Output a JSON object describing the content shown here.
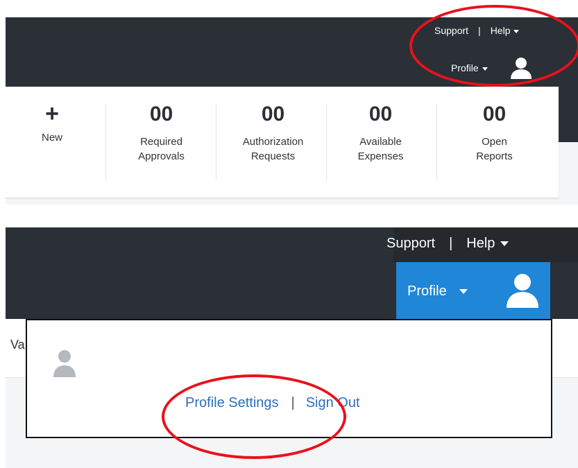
{
  "panel1": {
    "utility_nav": {
      "support": "Support",
      "separator": "|",
      "help": "Help"
    },
    "profile_label": "Profile",
    "tiles": [
      {
        "value": "+",
        "line1": "New",
        "line2": ""
      },
      {
        "value": "00",
        "line1": "Required",
        "line2": "Approvals"
      },
      {
        "value": "00",
        "line1": "Authorization",
        "line2": "Requests"
      },
      {
        "value": "00",
        "line1": "Available",
        "line2": "Expenses"
      },
      {
        "value": "00",
        "line1": "Open",
        "line2": "Reports"
      }
    ]
  },
  "panel2": {
    "utility_nav": {
      "support": "Support",
      "separator": "|",
      "help": "Help"
    },
    "profile_label": "Profile",
    "partial_text": "Va",
    "dropdown": {
      "profile_settings": "Profile Settings",
      "separator": "|",
      "sign_out": "Sign Out"
    }
  },
  "colors": {
    "header": "#2b2f36",
    "profile_active": "#1f86d8",
    "highlight_circle": "#e8121b",
    "link": "#2a6fbd"
  },
  "icons": [
    "plus-icon",
    "user-avatar-icon",
    "caret-down-icon"
  ]
}
